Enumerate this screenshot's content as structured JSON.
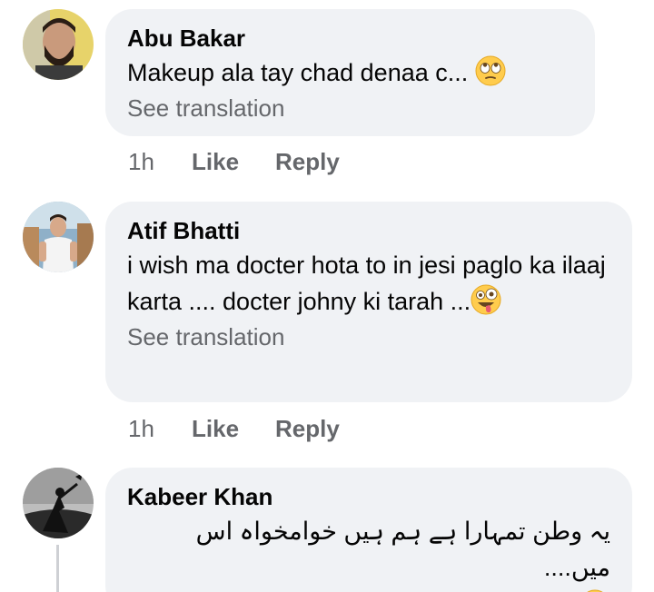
{
  "comments": [
    {
      "author": "Abu Bakar",
      "text": "Makeup ala tay chad denaa c...",
      "emoji": "face-with-rolling-eyes",
      "see_translation": "See translation",
      "time": "1h",
      "like": "Like",
      "reply": "Reply"
    },
    {
      "author": "Atif Bhatti",
      "text": "i wish ma docter hota to  in jesi paglo ka ilaaj karta .... docter johny ki tarah ...",
      "emoji": "zany-face",
      "see_translation": "See translation",
      "time": "1h",
      "like": "Like",
      "reply": "Reply"
    },
    {
      "author": "Kabeer Khan",
      "text": "یہ وطن تمہارا ہے ہم ہیں خوامخواہ اس میں....",
      "emoji": "crying-face"
    }
  ],
  "colors": {
    "bubble": "#f0f2f5",
    "primary_text": "#050505",
    "secondary_text": "#65676b",
    "emoji_yellow": "#ffcc4d"
  }
}
